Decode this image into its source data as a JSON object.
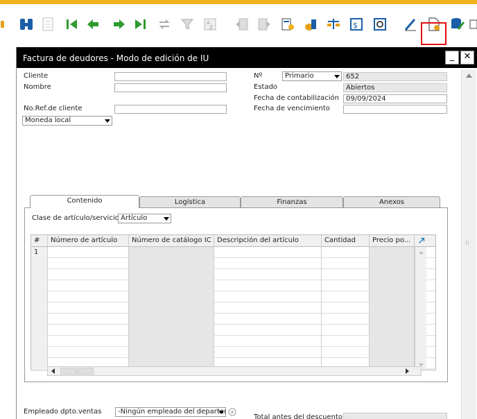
{
  "window": {
    "title": "Factura de deudores - Modo de edición de IU"
  },
  "toolbar": {
    "icons": [
      "find-icon",
      "document-icon",
      "first-record-icon",
      "previous-record-icon",
      "next-record-icon",
      "last-record-icon",
      "refresh-icon",
      "filter-icon",
      "sort-icon",
      "base-document-icon",
      "target-document-icon",
      "payment-means-icon",
      "gross-profit-icon",
      "volume-weight-icon",
      "journal-entry-icon",
      "settings-icon",
      "edit-form-icon",
      "new-field-icon",
      "database-icon",
      "window-icon"
    ]
  },
  "header": {
    "cliente_label": "Cliente",
    "nombre_label": "Nombre",
    "ref_label": "No.Ref.de cliente",
    "moneda_value": "Moneda local",
    "no_label": "Nº",
    "serie_value": "Primario",
    "numero_value": "652",
    "estado_label": "Estado",
    "estado_value": "Abiertos",
    "fecha_contab_label": "Fecha de contabilización",
    "fecha_contab_value": "09/09/2024",
    "fecha_venc_label": "Fecha de vencimiento"
  },
  "tabs": [
    {
      "label": "Contenido"
    },
    {
      "label": "Logística"
    },
    {
      "label": "Finanzas"
    },
    {
      "label": "Anexos"
    }
  ],
  "contenido": {
    "clase_label": "Clase de artículo/servicio",
    "clase_value": "Artículo"
  },
  "grid": {
    "headers": [
      "#",
      "Número de artículo",
      "Número de catálogo IC",
      "Descripción del artículo",
      "Cantidad",
      "Precio po..."
    ],
    "first_row_number": "1"
  },
  "footer": {
    "empleado_label": "Empleado dpto.ventas",
    "empleado_value": "-Ningún empleado del departar",
    "total_label": "Total antes del descuento"
  },
  "colors": {
    "accent_strip": "#f2b21c",
    "highlight": "#e01010",
    "titlebar": "#000000"
  }
}
